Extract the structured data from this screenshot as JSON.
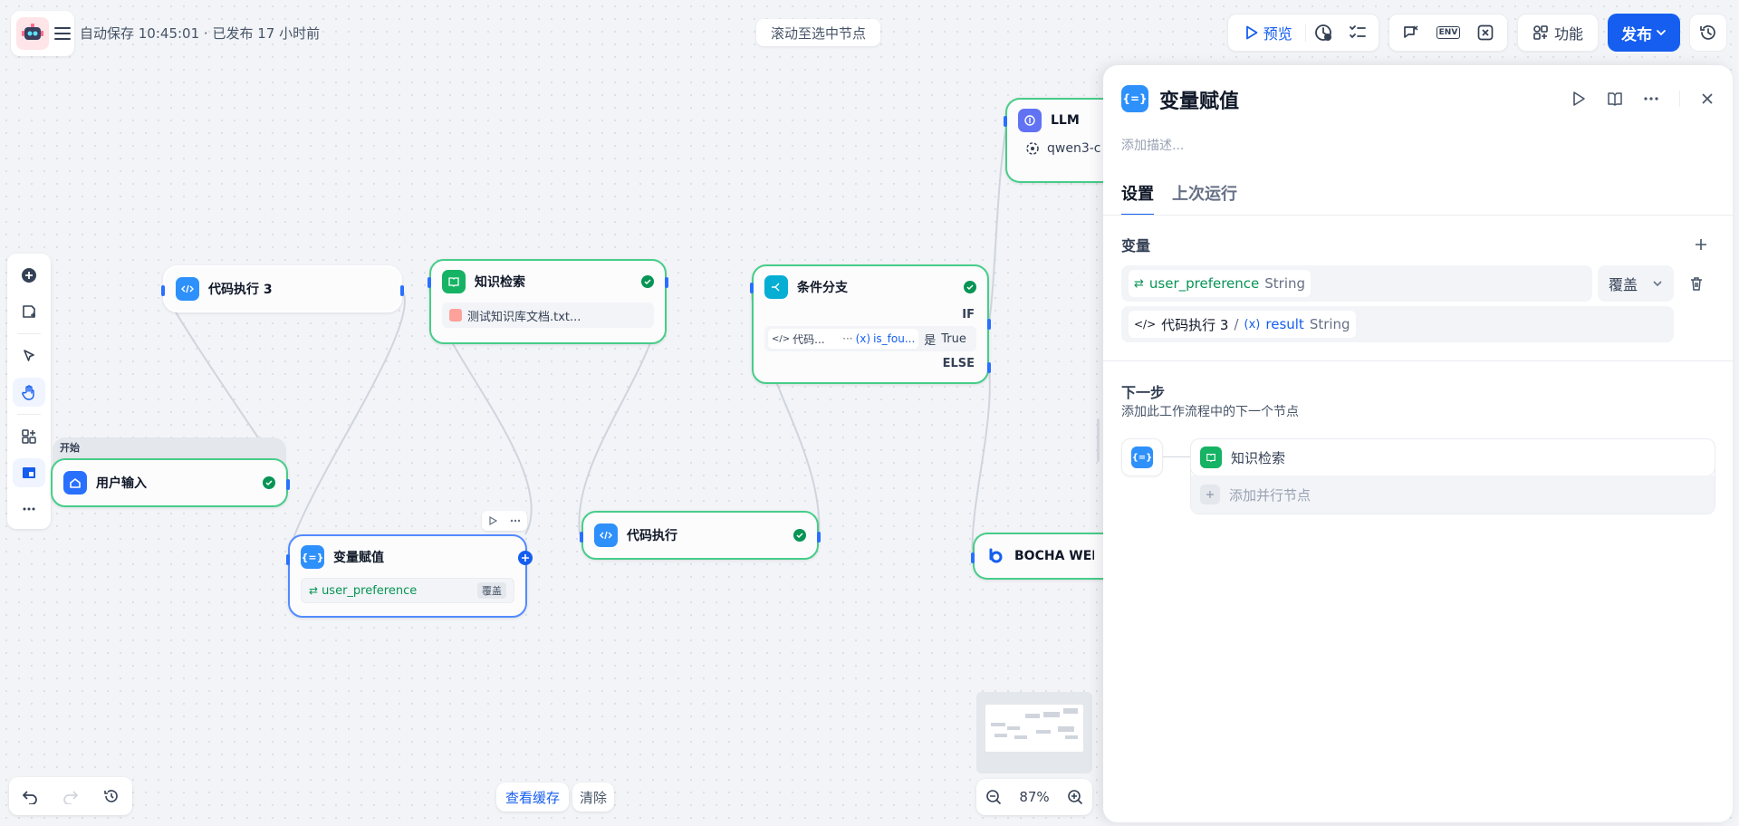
{
  "header": {
    "autosave_text": "自动保存 10:45:01 · 已发布 17 小时前",
    "scroll_to_selected": "滚动至选中节点",
    "preview_label": "预览",
    "env_label": "ENV",
    "features_label": "功能",
    "publish_label": "发布"
  },
  "nodes": {
    "start_label": "开始",
    "user_input": "用户输入",
    "code_exec_3": "代码执行 3",
    "knowledge": "知识检索",
    "knowledge_file": "测试知识库文档.txt...",
    "condition": "条件分支",
    "if_label": "IF",
    "else_label": "ELSE",
    "cond_var_source": "代码...",
    "cond_ellipsis": "···",
    "cond_var_name": "is_fou...",
    "cond_op": "是",
    "cond_value": "True",
    "assign": "变量赋值",
    "assign_var": "user_preference",
    "assign_mode": "覆盖",
    "code_exec": "代码执行",
    "llm": "LLM",
    "llm_model": "qwen3-c",
    "bocha": "BOCHA WEB"
  },
  "bottom": {
    "view_cache": "查看缓存",
    "clear": "清除",
    "zoom": "87%"
  },
  "panel": {
    "title": "变量赋值",
    "desc_placeholder": "添加描述...",
    "tabs": [
      "设置",
      "上次运行"
    ],
    "variables_label": "变量",
    "var_name": "user_preference",
    "var_type": "String",
    "mode": "覆盖",
    "source_node": "代码执行 3",
    "source_sep": "/",
    "source_var": "result",
    "source_type": "String",
    "next_step_title": "下一步",
    "next_step_desc": "添加此工作流程中的下一个节点",
    "next_node": "知识检索",
    "add_parallel": "添加并行节点"
  }
}
